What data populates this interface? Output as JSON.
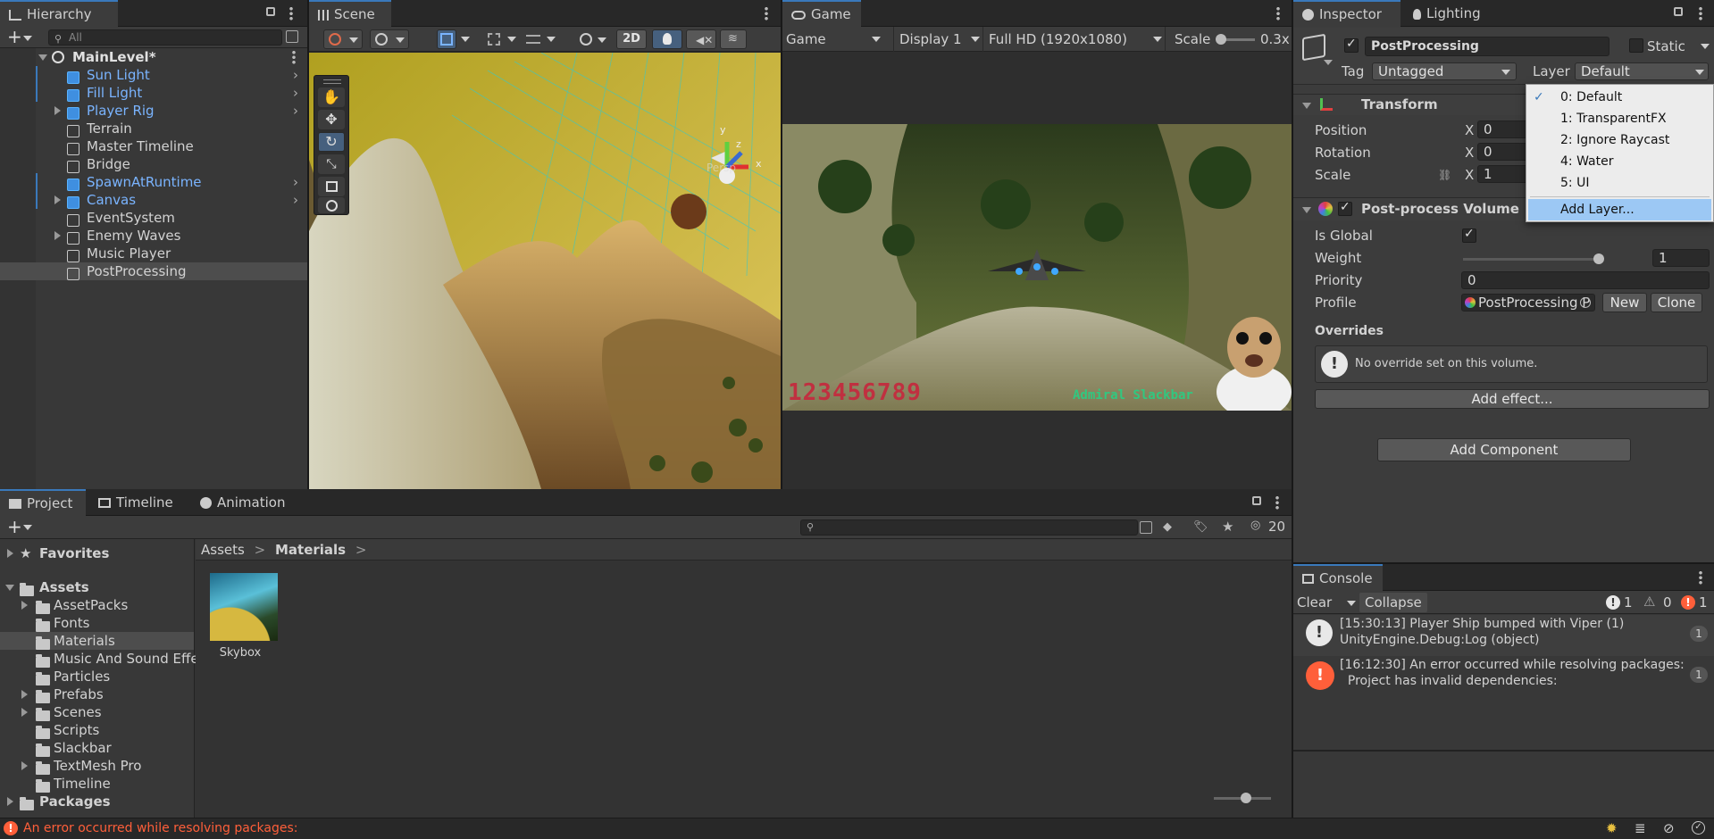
{
  "hierarchy": {
    "tab": "Hierarchy",
    "search_placeholder": "All",
    "scene": "MainLevel*",
    "items": [
      {
        "label": "Sun Light"
      },
      {
        "label": "Fill Light"
      },
      {
        "label": "Player Rig"
      },
      {
        "label": "Terrain"
      },
      {
        "label": "Master Timeline"
      },
      {
        "label": "Bridge"
      },
      {
        "label": "SpawnAtRuntime"
      },
      {
        "label": "Canvas"
      },
      {
        "label": "EventSystem"
      },
      {
        "label": "Enemy Waves"
      },
      {
        "label": "Music Player"
      },
      {
        "label": "PostProcessing"
      }
    ]
  },
  "scene_view": {
    "tab": "Scene",
    "mode_2d": "2D",
    "persp_label": "Persp",
    "axis_y": "y",
    "axis_x": "x",
    "axis_z": "z"
  },
  "game_view": {
    "tab": "Game",
    "view_dropdown": "Game",
    "display_dropdown": "Display 1",
    "resolution_dropdown": "Full HD (1920x1080)",
    "scale_label": "Scale",
    "scale_value": "0.3x",
    "hud_score": "123456789",
    "hud_name": "Admiral Slackbar"
  },
  "inspector": {
    "tab": "Inspector",
    "tab_lighting": "Lighting",
    "object_name": "PostProcessing",
    "static_label": "Static",
    "tag_label": "Tag",
    "tag_value": "Untagged",
    "layer_label": "Layer",
    "layer_value": "Default",
    "transform": {
      "title": "Transform",
      "position_label": "Position",
      "rotation_label": "Rotation",
      "scale_label": "Scale",
      "axis_x": "X",
      "position_x": "0",
      "rotation_x": "0",
      "scale_x": "1"
    },
    "volume": {
      "title": "Post-process Volume",
      "is_global_label": "Is Global",
      "weight_label": "Weight",
      "weight_value": "1",
      "weight_fraction": 1.0,
      "priority_label": "Priority",
      "priority_value": "0",
      "profile_label": "Profile",
      "profile_value": "PostProcessing P",
      "new_button": "New",
      "clone_button": "Clone",
      "overrides_label": "Overrides",
      "no_override_text": "No override set on this volume.",
      "add_effect_button": "Add effect..."
    },
    "add_component_button": "Add Component",
    "layer_menu": [
      {
        "label": "0: Default",
        "checked": true
      },
      {
        "label": "1: TransparentFX",
        "checked": false
      },
      {
        "label": "2: Ignore Raycast",
        "checked": false
      },
      {
        "label": "4: Water",
        "checked": false
      },
      {
        "label": "5: UI",
        "checked": false
      }
    ],
    "layer_menu_add": "Add Layer..."
  },
  "project": {
    "tabs": [
      "Project",
      "Timeline",
      "Animation"
    ],
    "hidden_count": "20",
    "favorites": "Favorites",
    "assets": "Assets",
    "asset_folders": [
      {
        "label": "AssetPacks",
        "expandable": true
      },
      {
        "label": "Fonts",
        "expandable": false
      },
      {
        "label": "Materials",
        "expandable": false
      },
      {
        "label": "Music And Sound Effe",
        "expandable": false
      },
      {
        "label": "Particles",
        "expandable": false
      },
      {
        "label": "Prefabs",
        "expandable": true
      },
      {
        "label": "Scenes",
        "expandable": true
      },
      {
        "label": "Scripts",
        "expandable": false
      },
      {
        "label": "Slackbar",
        "expandable": false
      },
      {
        "label": "TextMesh Pro",
        "expandable": true
      },
      {
        "label": "Timeline",
        "expandable": false
      }
    ],
    "packages": "Packages",
    "breadcrumb": [
      "Assets",
      "Materials"
    ],
    "asset_item": "Skybox"
  },
  "console": {
    "tab": "Console",
    "clear_button": "Clear",
    "collapse_button": "Collapse",
    "log_count": "1",
    "warn_count": "0",
    "error_count": "1",
    "entries": [
      {
        "line1": "[15:30:13] Player Ship bumped with Viper (1)",
        "line2": "UnityEngine.Debug:Log (object)",
        "count": "1",
        "kind": "log"
      },
      {
        "line1": "[16:12:30] An error occurred while resolving packages:",
        "line2": "  Project has invalid dependencies:",
        "count": "1",
        "kind": "error"
      }
    ]
  },
  "status_bar": {
    "message": "An error occurred while resolving packages:"
  },
  "colors": {
    "accent": "#3a79bb",
    "selection": "#4d4d4d",
    "error": "#ff5f3a",
    "prefab_blue": "#7ab4ff"
  }
}
